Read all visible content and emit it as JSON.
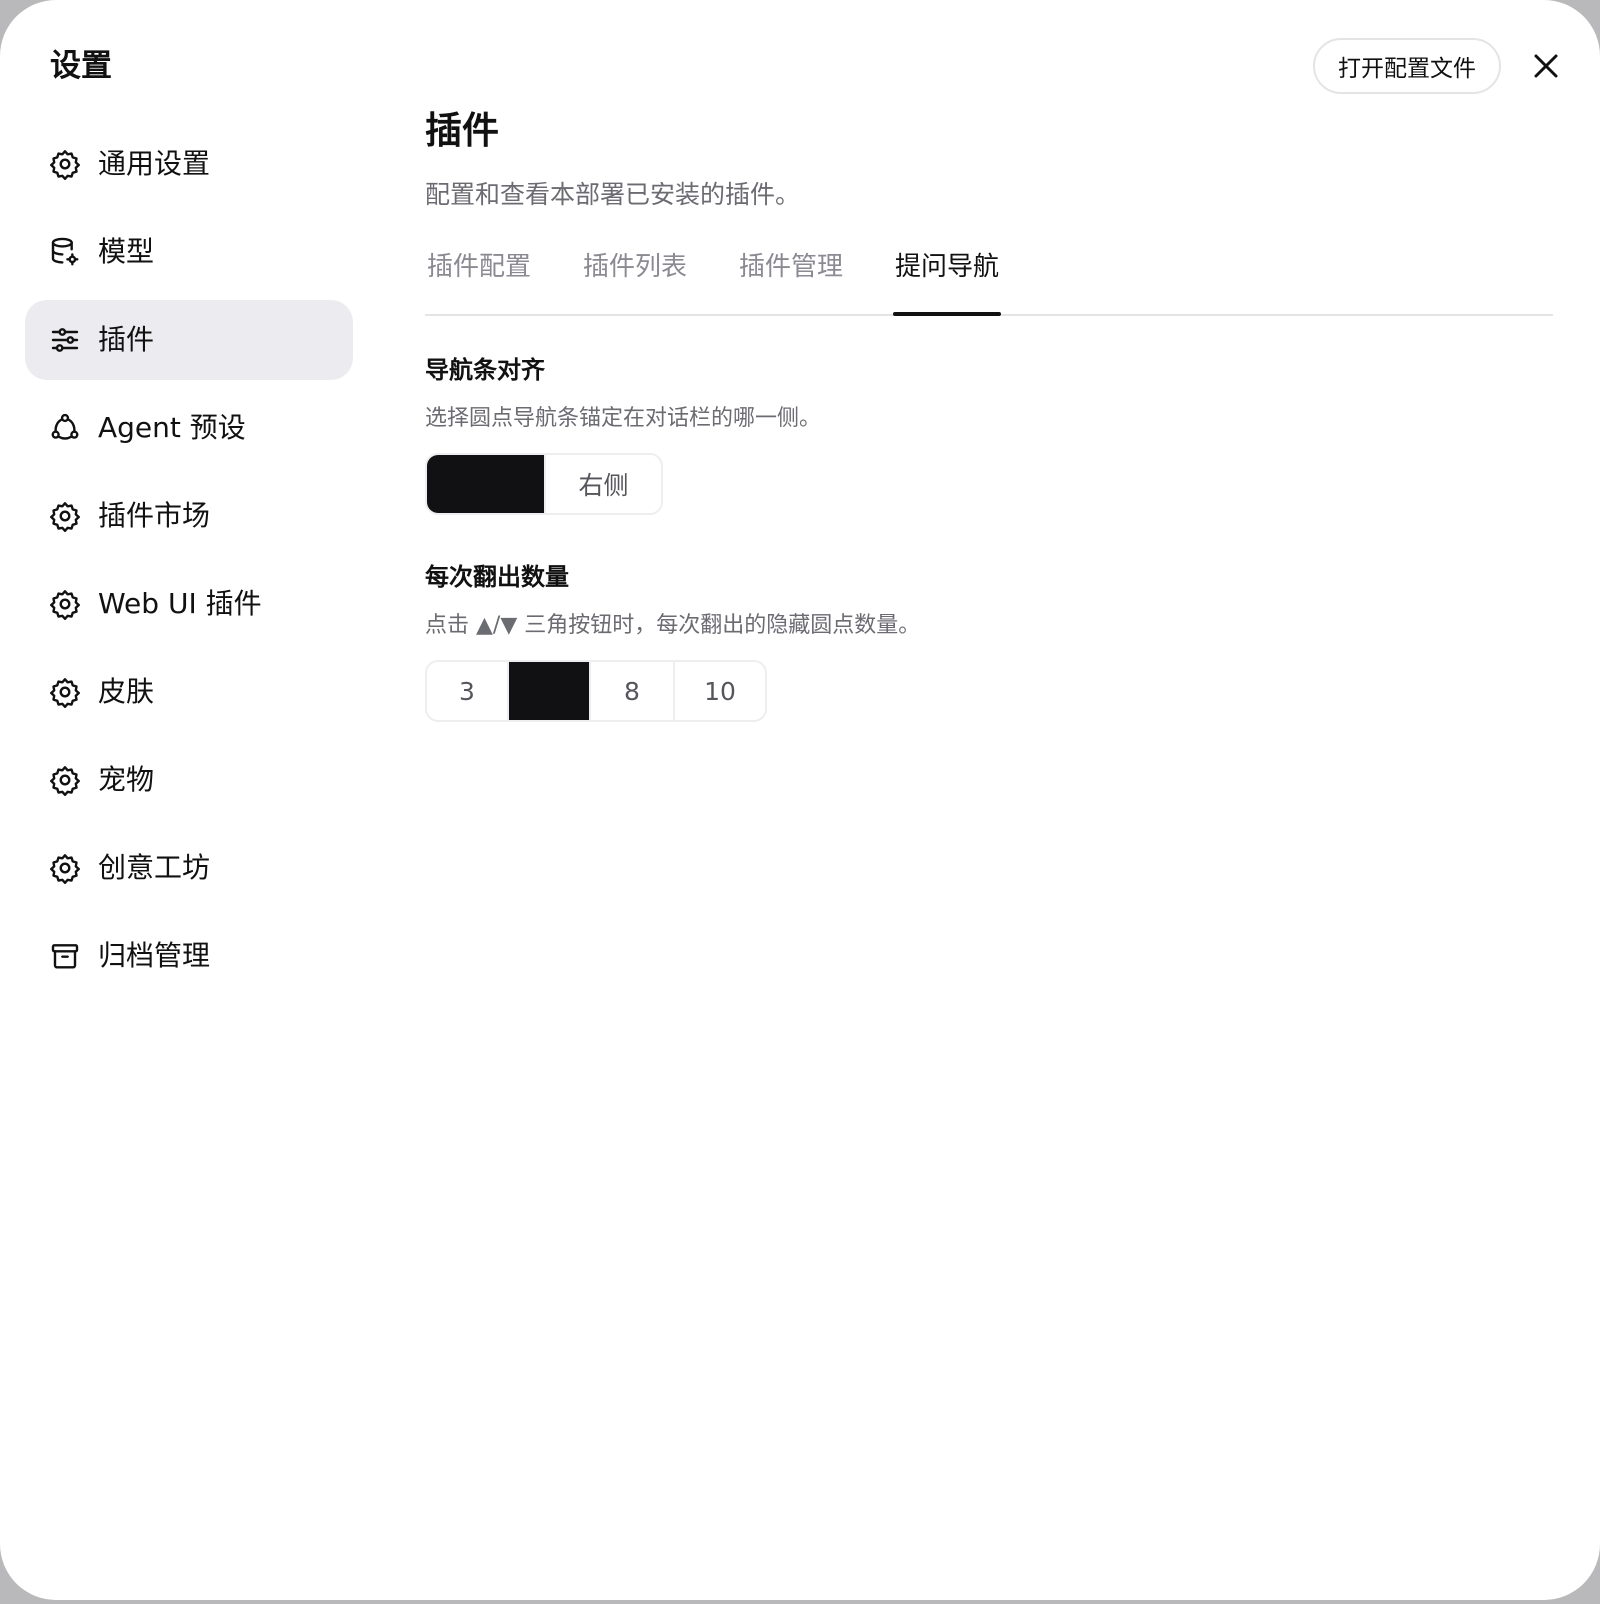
{
  "header": {
    "title": "设置",
    "open_config_label": "打开配置文件",
    "close_icon": "close-icon"
  },
  "sidebar": {
    "items": [
      {
        "label": "通用设置",
        "icon": "gear-icon",
        "active": false
      },
      {
        "label": "模型",
        "icon": "database-gear-icon",
        "active": false
      },
      {
        "label": "插件",
        "icon": "sliders-icon",
        "active": true
      },
      {
        "label": "Agent 预设",
        "icon": "agent-nodes-icon",
        "active": false
      },
      {
        "label": "插件市场",
        "icon": "gear-icon",
        "active": false
      },
      {
        "label": "Web UI 插件",
        "icon": "gear-icon",
        "active": false
      },
      {
        "label": "皮肤",
        "icon": "gear-icon",
        "active": false
      },
      {
        "label": "宠物",
        "icon": "gear-icon",
        "active": false
      },
      {
        "label": "创意工坊",
        "icon": "gear-icon",
        "active": false
      },
      {
        "label": "归档管理",
        "icon": "archive-icon",
        "active": false
      }
    ]
  },
  "main": {
    "title": "插件",
    "description": "配置和查看本部署已安装的插件。",
    "tabs": [
      {
        "label": "插件配置",
        "active": false
      },
      {
        "label": "插件列表",
        "active": false
      },
      {
        "label": "插件管理",
        "active": false
      },
      {
        "label": "提问导航",
        "active": true
      }
    ],
    "nav_align": {
      "title": "导航条对齐",
      "description": "选择圆点导航条锚定在对话栏的哪一侧。",
      "options": [
        {
          "label": "",
          "selected": true
        },
        {
          "label": "右侧",
          "selected": false
        }
      ]
    },
    "reveal_count": {
      "title": "每次翻出数量",
      "description": "点击 ▲/▼ 三角按钮时，每次翻出的隐藏圆点数量。",
      "options": [
        {
          "label": "3",
          "selected": false
        },
        {
          "label": "",
          "selected": true
        },
        {
          "label": "8",
          "selected": false
        },
        {
          "label": "10",
          "selected": false
        }
      ]
    }
  },
  "colors": {
    "selected": "#111114",
    "active_nav_bg": "#ececf0",
    "muted_text": "#6b6b72",
    "border": "#e4e4e7"
  }
}
